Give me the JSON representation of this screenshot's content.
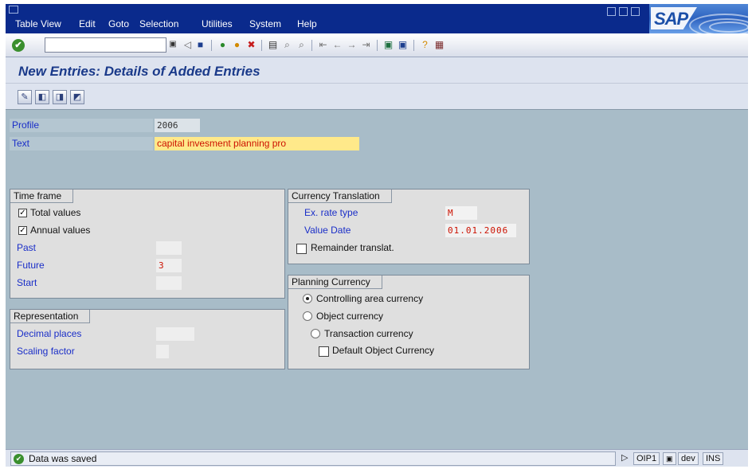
{
  "menu": [
    "Table View",
    "Edit",
    "Goto",
    "Selection",
    "Utilities",
    "System",
    "Help"
  ],
  "toolbar": {
    "command_value": "",
    "icons": [
      "back-icon",
      "save-icon",
      "back-nav-icon",
      "exit-icon",
      "cancel-icon",
      "print-icon",
      "find-icon",
      "find-next-icon",
      "first-page-icon",
      "prev-page-icon",
      "next-page-icon",
      "last-page-icon",
      "create-session-icon",
      "shortcut-icon",
      "help-icon",
      "layout-icon"
    ]
  },
  "title": "New Entries: Details of Added Entries",
  "header_fields": {
    "profile_label": "Profile",
    "profile_value": "2006",
    "text_label": "Text",
    "text_value": "capital invesment planning pro"
  },
  "time_frame": {
    "title": "Time frame",
    "total_values": "Total values",
    "annual_values": "Annual values",
    "past_label": "Past",
    "past_value": "",
    "future_label": "Future",
    "future_value": "3",
    "start_label": "Start",
    "start_value": ""
  },
  "representation": {
    "title": "Representation",
    "decimal_label": "Decimal places",
    "decimal_value": "",
    "scaling_label": "Scaling factor",
    "scaling_value": ""
  },
  "currency_translation": {
    "title": "Currency Translation",
    "ex_rate_label": "Ex. rate type",
    "ex_rate_value": "M",
    "value_date_label": "Value Date",
    "value_date_value": "01.01.2006",
    "remainder_label": "Remainder translat."
  },
  "planning_currency": {
    "title": "Planning Currency",
    "controlling": "Controlling area currency",
    "object": "Object currency",
    "transaction": "Transaction currency",
    "default_object": "Default Object Currency"
  },
  "status": {
    "message": "Data was saved",
    "system": "OIP1",
    "client": "dev",
    "mode": "INS"
  },
  "colors": {
    "menubar": "#0a2a8c",
    "workarea": "#a8bcc8",
    "label": "#1a2ec8",
    "required_text": "#cc1100",
    "highlight_field": "#ffe98a"
  }
}
